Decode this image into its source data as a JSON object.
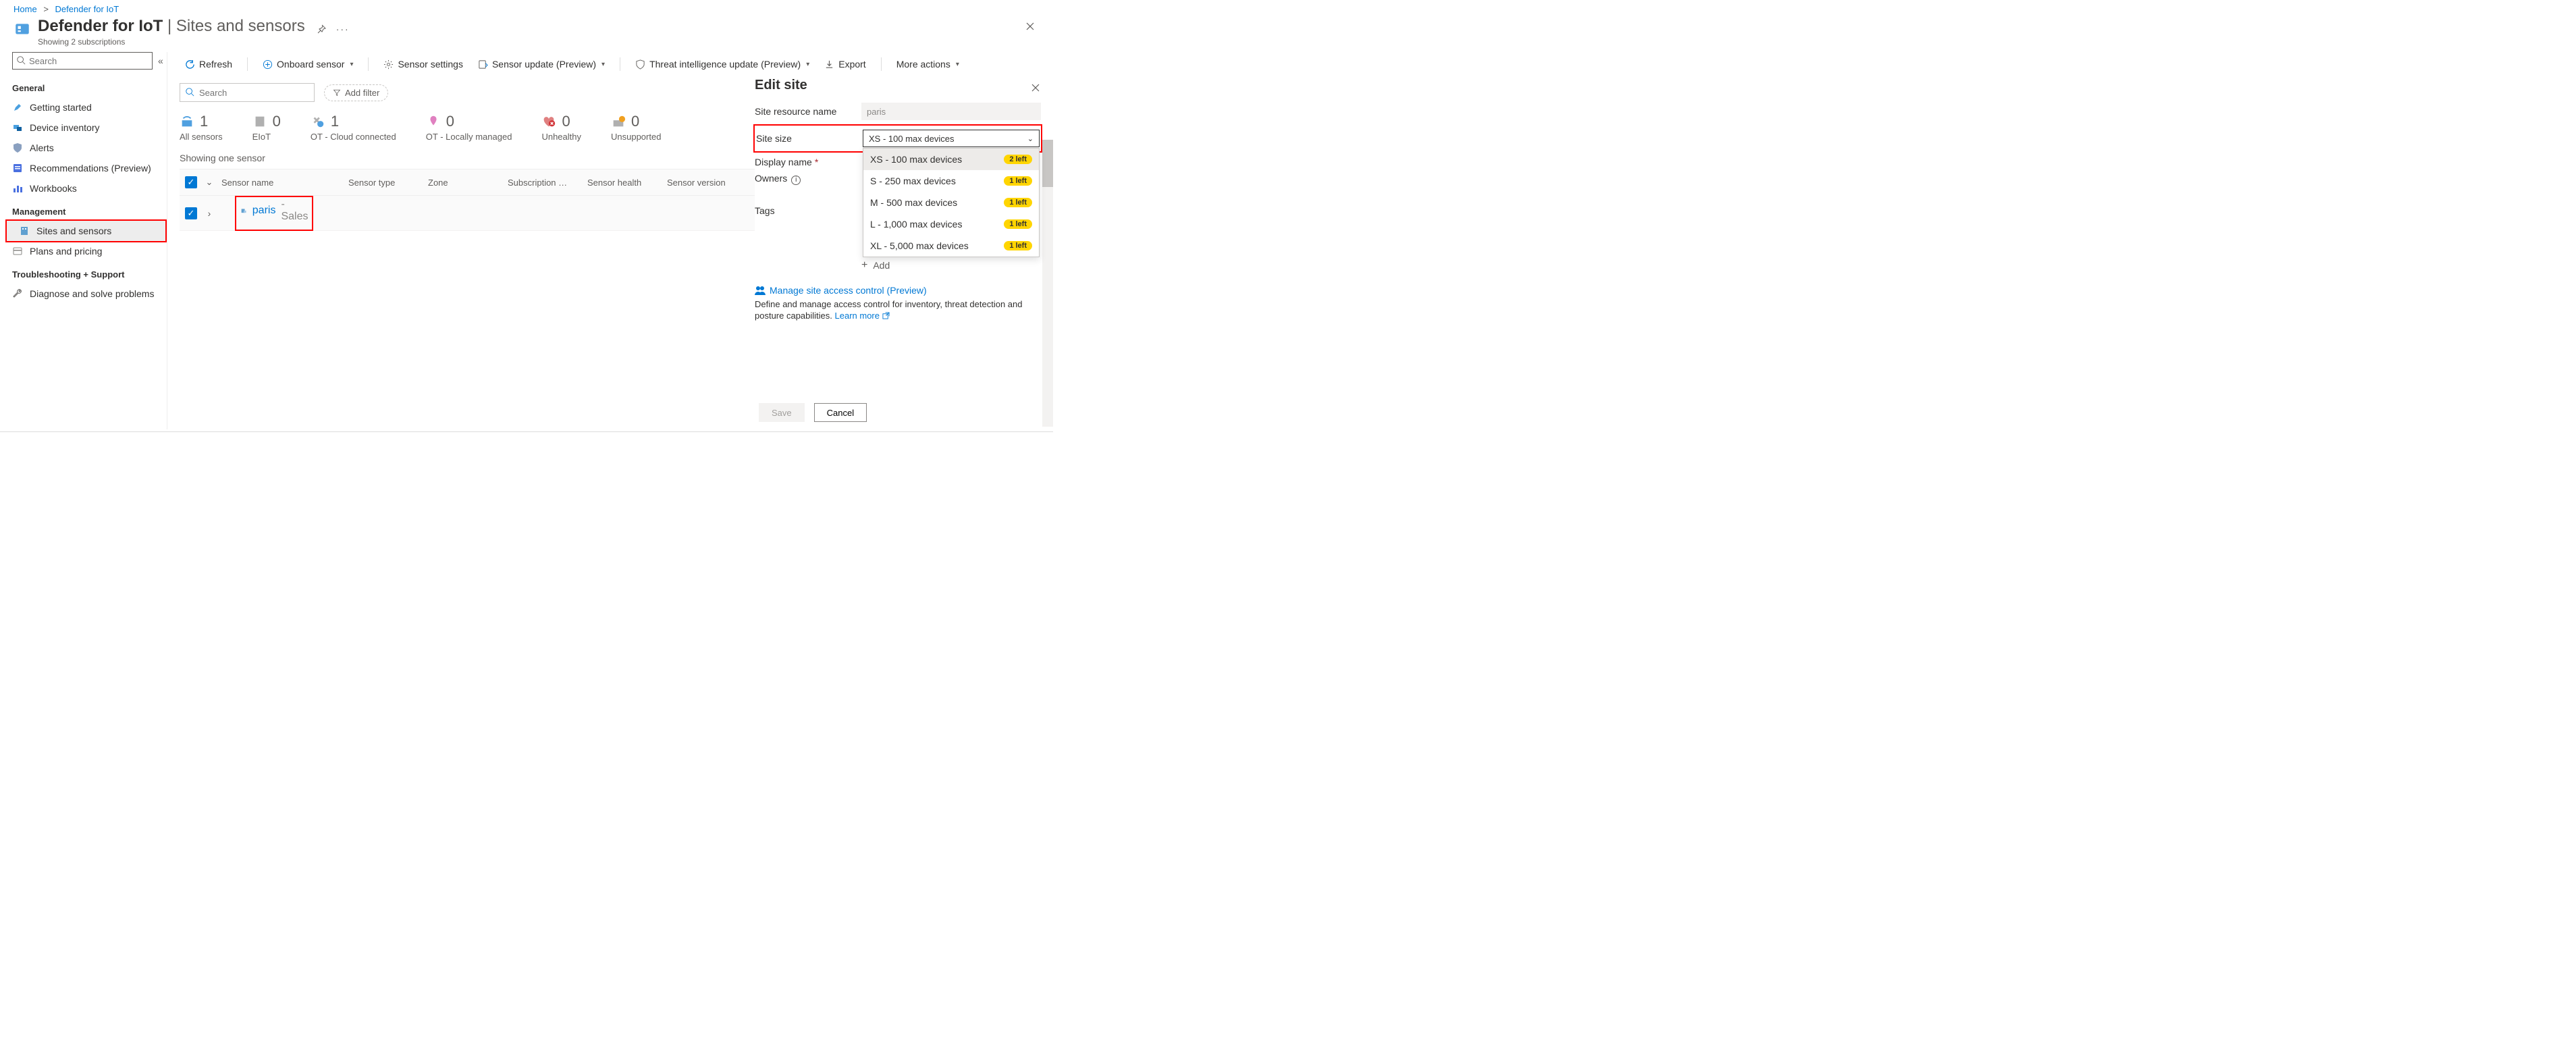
{
  "breadcrumb": {
    "home": "Home",
    "d4iot": "Defender for IoT"
  },
  "header": {
    "title": "Defender for IoT",
    "subtitle": "Sites and sensors",
    "subcount": "Showing 2 subscriptions"
  },
  "sidebar": {
    "search_placeholder": "Search",
    "groups": {
      "general": "General",
      "management": "Management",
      "trouble": "Troubleshooting + Support"
    },
    "items": {
      "getting_started": "Getting started",
      "device_inventory": "Device inventory",
      "alerts": "Alerts",
      "recommendations": "Recommendations (Preview)",
      "workbooks": "Workbooks",
      "sites_sensors": "Sites and sensors",
      "plans_pricing": "Plans and pricing",
      "diagnose": "Diagnose and solve problems"
    }
  },
  "toolbar": {
    "refresh": "Refresh",
    "onboard": "Onboard sensor",
    "sensor_settings": "Sensor settings",
    "sensor_update": "Sensor update (Preview)",
    "ti_update": "Threat intelligence update (Preview)",
    "export": "Export",
    "more": "More actions"
  },
  "filter": {
    "search_placeholder": "Search",
    "add_filter": "Add filter"
  },
  "stats": {
    "all": {
      "num": "1",
      "label": "All sensors"
    },
    "eiot": {
      "num": "0",
      "label": "EIoT"
    },
    "ot_cloud": {
      "num": "1",
      "label": "OT - Cloud connected"
    },
    "ot_local": {
      "num": "0",
      "label": "OT - Locally managed"
    },
    "unhealthy": {
      "num": "0",
      "label": "Unhealthy"
    },
    "unsupported": {
      "num": "0",
      "label": "Unsupported"
    }
  },
  "showing": "Showing one sensor",
  "table": {
    "headers": {
      "sensor_name": "Sensor name",
      "sensor_type": "Sensor type",
      "zone": "Zone",
      "subscription": "Subscription …",
      "sensor_health": "Sensor health",
      "sensor_version": "Sensor version"
    },
    "row": {
      "site": "paris",
      "tag": " - Sales"
    }
  },
  "panel": {
    "title": "Edit site",
    "labels": {
      "resource_name": "Site resource name",
      "site_size": "Site size",
      "display_name": "Display name",
      "owners": "Owners",
      "tags": "Tags",
      "add": "Add"
    },
    "resource_name_value": "paris",
    "site_size_selected": "XS - 100 max devices",
    "options": [
      {
        "label": "XS - 100 max devices",
        "badge": "2 left"
      },
      {
        "label": "S - 250 max devices",
        "badge": "1 left"
      },
      {
        "label": "M - 500 max devices",
        "badge": "1 left"
      },
      {
        "label": "L - 1,000 max devices",
        "badge": "1 left"
      },
      {
        "label": "XL - 5,000 max devices",
        "badge": "1 left"
      }
    ],
    "manage_link": "Manage site access control (Preview)",
    "manage_desc": "Define and manage access control for inventory, threat detection and posture capabilities.  ",
    "learn_more": "Learn more",
    "save": "Save",
    "cancel": "Cancel"
  }
}
